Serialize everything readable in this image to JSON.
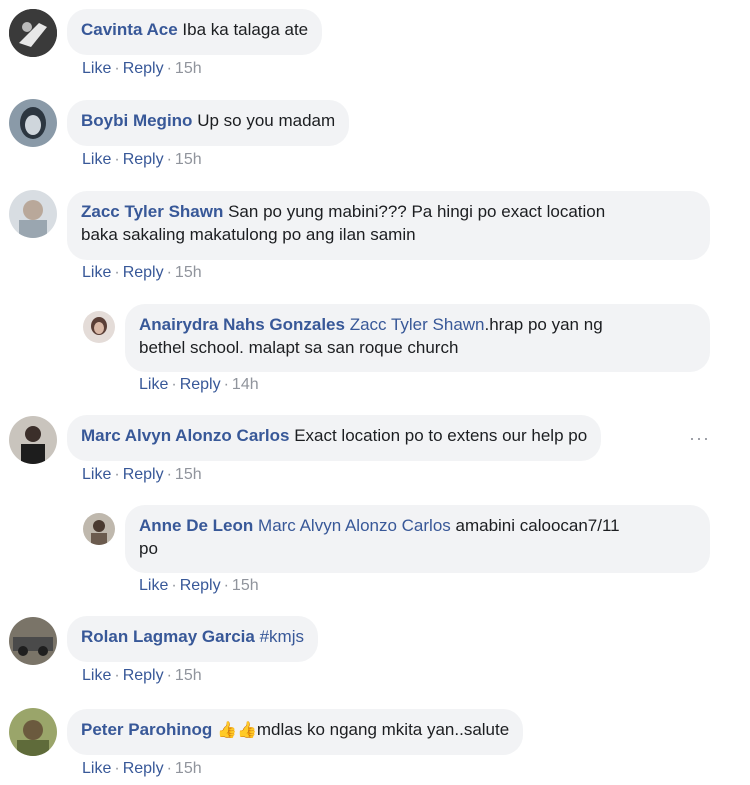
{
  "comments": [
    {
      "author": "Cavinta Ace",
      "text": "Iba ka talaga ate",
      "like": "Like",
      "reply": "Reply",
      "time": "15h"
    },
    {
      "author": "Boybi Megino",
      "text": "Up so you madam",
      "like": "Like",
      "reply": "Reply",
      "time": "15h"
    },
    {
      "author": "Zacc Tyler Shawn",
      "text": "San po yung mabini??? Pa hingi po exact location",
      "text2": "baka sakaling makatulong po ang ilan samin",
      "like": "Like",
      "reply": "Reply",
      "time": "15h"
    },
    {
      "author": "Anairydra Nahs Gonzales",
      "mention": "Zacc Tyler Shawn",
      "text": ".hrap po yan ng",
      "text2": "bethel school. malapt sa san roque church",
      "like": "Like",
      "reply": "Reply",
      "time": "14h"
    },
    {
      "author": "Marc Alvyn Alonzo Carlos",
      "text": "Exact location po to extens our help po",
      "like": "Like",
      "reply": "Reply",
      "time": "15h"
    },
    {
      "author": "Anne De Leon",
      "mention": "Marc Alvyn Alonzo Carlos",
      "text": " amabini caloocan7/11",
      "text2": "po",
      "like": "Like",
      "reply": "Reply",
      "time": "15h"
    },
    {
      "author": "Rolan Lagmay Garcia",
      "hashtag": "#kmjs",
      "like": "Like",
      "reply": "Reply",
      "time": "15h"
    },
    {
      "author": "Peter Parohinog",
      "emoji": "👍👍",
      "text": "mdlas ko ngang mkita yan..salute",
      "like": "Like",
      "reply": "Reply",
      "time": "15h"
    }
  ],
  "more_options": "···",
  "separator": "·",
  "colors": {
    "author_link": "#385898",
    "bubble_bg": "#f2f3f5",
    "meta_gray": "#90949c",
    "text": "#1c1e21"
  }
}
